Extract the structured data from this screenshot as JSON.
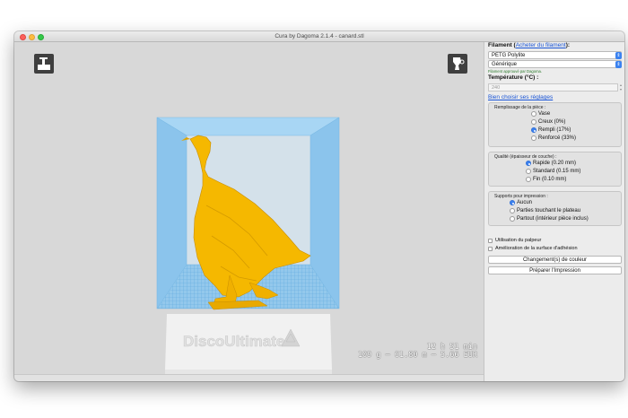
{
  "window": {
    "title": "Cura by Dagoma 2.1.4 - canard.stl"
  },
  "viewport": {
    "printer_brand": "DiscoUltimate",
    "stats": {
      "time": "12 h 51 min",
      "usage": "109 g – 61.80 m – 5.66 EUR"
    },
    "open_tool_icon": "open-file-icon",
    "filament_tool_icon": "filament-spool-icon",
    "model_color": "#f5b800",
    "volume_color": "#8fc9ef"
  },
  "panel": {
    "filament": {
      "label": "Filament",
      "buy_link": "Acheter du filament",
      "paren_open": "(",
      "paren_close": "):",
      "type_value": "PETG Polylite",
      "brand_value": "Générique",
      "hint": "Filament approuvé par Dagoma."
    },
    "temperature": {
      "label": "Température (°C) :",
      "value": "240"
    },
    "settings_help_link": "Bien choisir ses réglages",
    "infill": {
      "title": "Remplissage de la pièce :",
      "options": [
        "Vase",
        "Creux (0%)",
        "Rempli (17%)",
        "Renforcé (33%)"
      ],
      "selected": "Rempli (17%)"
    },
    "quality": {
      "title": "Qualité (épaisseur de couche) :",
      "options": [
        "Rapide (0.20 mm)",
        "Standard (0.15 mm)",
        "Fin (0.10 mm)"
      ],
      "selected": "Rapide (0.20 mm)"
    },
    "supports": {
      "title": "Supports pour impression :",
      "options": [
        "Aucun",
        "Parties touchant le plateau",
        "Partout (intérieur pièce inclus)"
      ],
      "selected": "Aucun"
    },
    "checks": [
      "Utilisation du palpeur",
      "Amélioration de la surface d'adhésion"
    ],
    "color_change_button": "Changement(s) de couleur",
    "prepare_button": "Préparer l'Impression"
  }
}
